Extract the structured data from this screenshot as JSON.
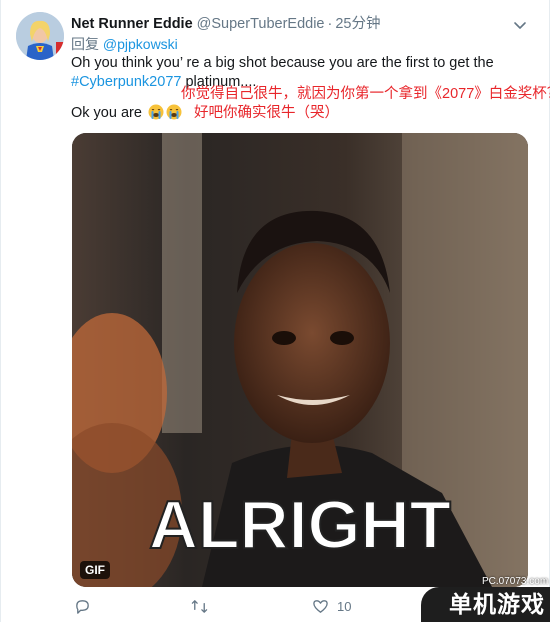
{
  "tweet": {
    "display_name": "Net Runner Eddie",
    "handle": "@SuperTuberEddie",
    "separator": "·",
    "time": "25分钟",
    "replying_label": "回复",
    "replying_mention": "@pjpkowski",
    "text_line1": "Oh you think you’  re a big shot because you are the first to get the",
    "hashtag": "#Cyberpunk2077",
    "text_line2_rest": " platinum....",
    "text_line3": "Ok you are"
  },
  "annotations": {
    "translation_1": "你觉得自己很牛，就因为你第一个拿到《2077》白金奖杯？",
    "translation_2": "好吧你确实很牛（哭）"
  },
  "media": {
    "caption_text": "ALRIGHT",
    "badge": "GIF"
  },
  "actions": {
    "like_count": "10"
  },
  "watermark": {
    "url": "PC.07073.com",
    "label": "单机游戏"
  },
  "icons": {
    "reply": "reply-icon",
    "retweet": "retweet-icon",
    "like": "heart-icon",
    "menu": "chevron-down-icon",
    "emoji": "crying-face-icon"
  },
  "colors": {
    "link": "#1b95e0",
    "secondary": "#657786",
    "annotation": "#e8262b"
  }
}
